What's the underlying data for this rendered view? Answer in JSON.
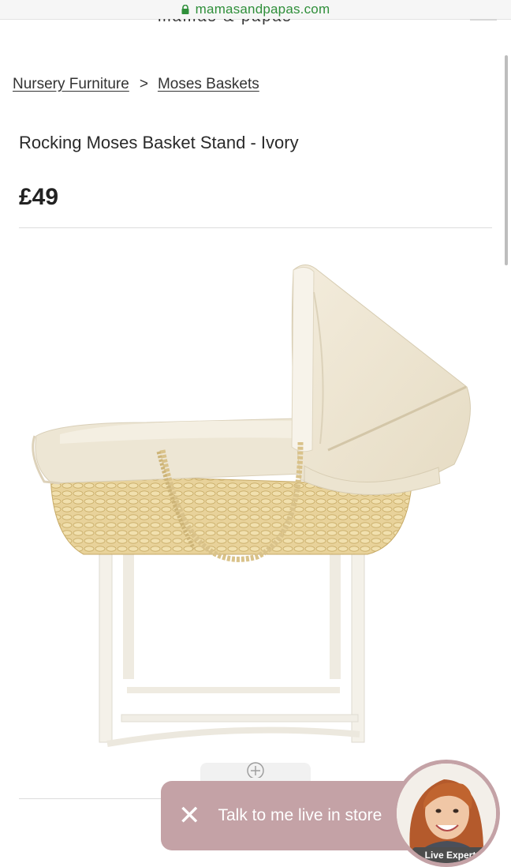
{
  "browser": {
    "url": "mamasandpapas.com",
    "logo_fragment": "mamas & papas"
  },
  "breadcrumb": {
    "items": [
      "Nursery Furniture",
      "Moses Baskets"
    ],
    "separator": ">"
  },
  "product": {
    "title": "Rocking Moses Basket Stand - Ivory",
    "price": "£49",
    "image_alt": "Ivory Moses basket on a white rocking stand"
  },
  "chat": {
    "label": "Talk to me live in store",
    "badge": "Live Expert"
  },
  "colors": {
    "url_green": "#2f8f3a",
    "chat_bg": "#c4a2a6"
  },
  "icons": {
    "lock": "lock-icon",
    "close": "close-icon",
    "zoom": "zoom-plus-icon"
  }
}
